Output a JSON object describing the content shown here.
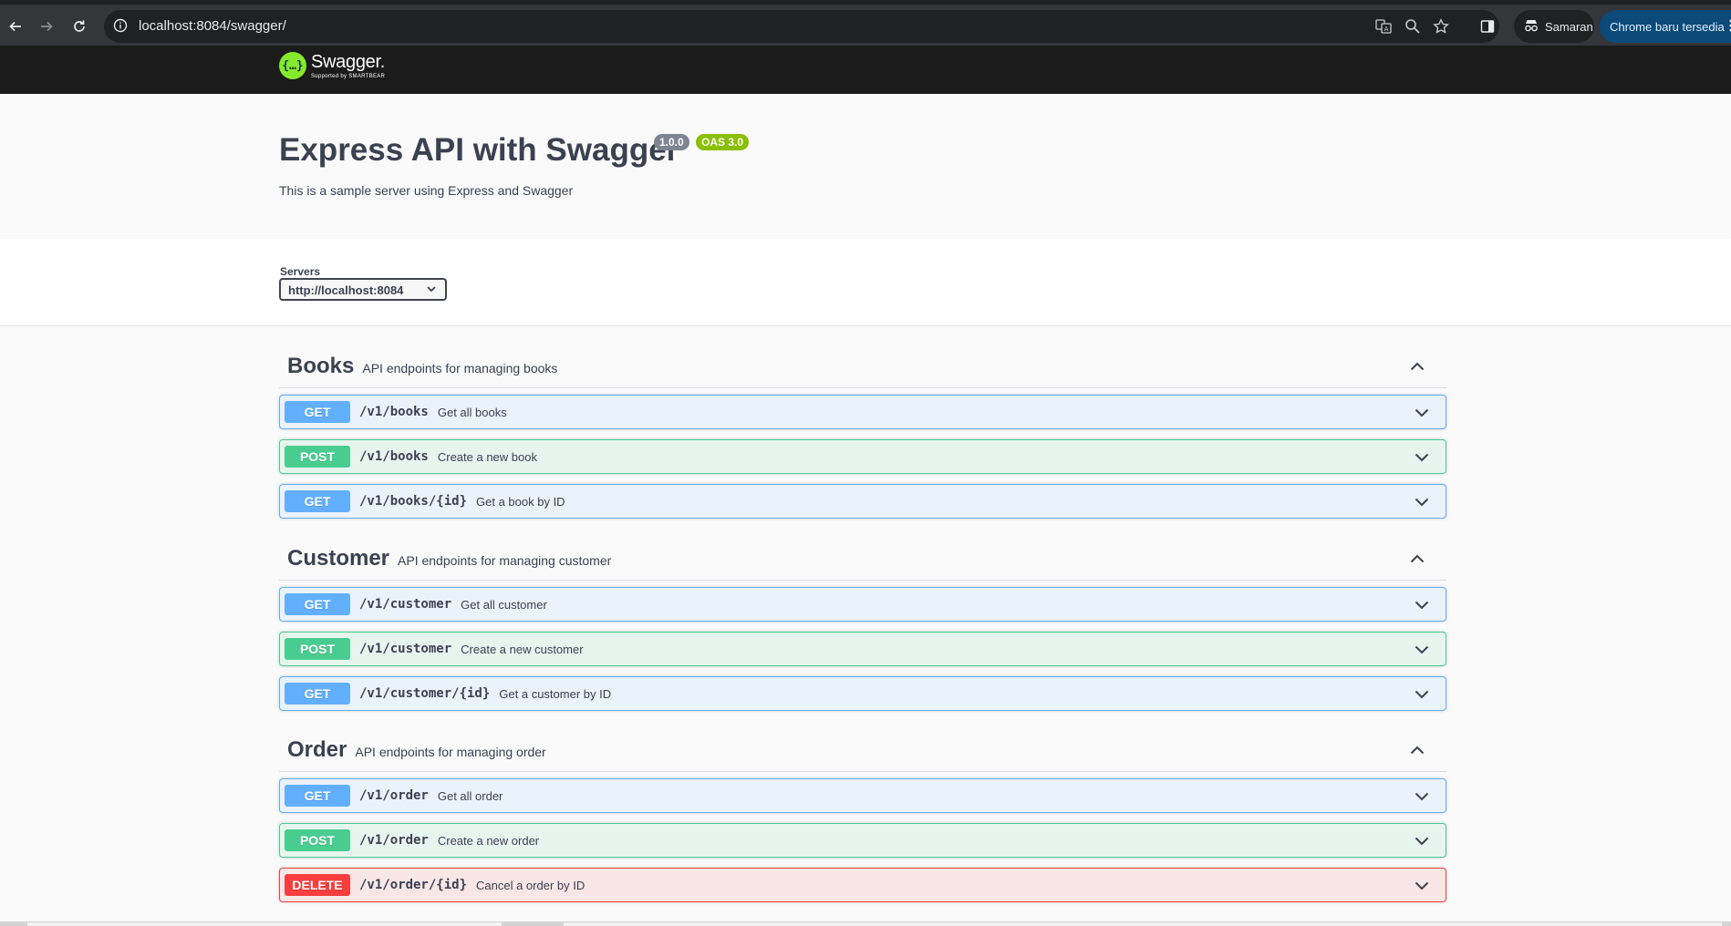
{
  "browser": {
    "url": "localhost:8084/swagger/",
    "profile_label": "Samaran",
    "update_label": "Chrome baru tersedia",
    "icons": [
      "back-icon",
      "forward-icon",
      "reload-icon",
      "site-info-icon",
      "translate-icon",
      "zoom-icon",
      "bookmark-star-icon",
      "side-panel-icon",
      "incognito-icon",
      "more-icon"
    ]
  },
  "topbar": {
    "logo_mark": "{…}",
    "logo_name": "Swagger.",
    "logo_sub": "Supported by SMARTBEAR"
  },
  "info": {
    "title": "Express API with Swagger",
    "version": "1.0.0",
    "oas": "OAS 3.0",
    "description": "This is a sample server using Express and Swagger"
  },
  "servers": {
    "label": "Servers",
    "selected": "http://localhost:8084"
  },
  "tags": [
    {
      "name": "Books",
      "description": "API endpoints for managing books",
      "operations": [
        {
          "method": "GET",
          "path": "/v1/books",
          "summary": "Get all books"
        },
        {
          "method": "POST",
          "path": "/v1/books",
          "summary": "Create a new book"
        },
        {
          "method": "GET",
          "path": "/v1/books/{id}",
          "summary": "Get a book by ID"
        }
      ]
    },
    {
      "name": "Customer",
      "description": "API endpoints for managing customer",
      "operations": [
        {
          "method": "GET",
          "path": "/v1/customer",
          "summary": "Get all customer"
        },
        {
          "method": "POST",
          "path": "/v1/customer",
          "summary": "Create a new customer"
        },
        {
          "method": "GET",
          "path": "/v1/customer/{id}",
          "summary": "Get a customer by ID"
        }
      ]
    },
    {
      "name": "Order",
      "description": "API endpoints for managing order",
      "operations": [
        {
          "method": "GET",
          "path": "/v1/order",
          "summary": "Get all order"
        },
        {
          "method": "POST",
          "path": "/v1/order",
          "summary": "Create a new order"
        },
        {
          "method": "DELETE",
          "path": "/v1/order/{id}",
          "summary": "Cancel a order by ID"
        }
      ]
    }
  ],
  "colors": {
    "get": "#61affe",
    "post": "#49cc90",
    "delete": "#f93e3e",
    "swagger_green": "#85ea2d"
  }
}
